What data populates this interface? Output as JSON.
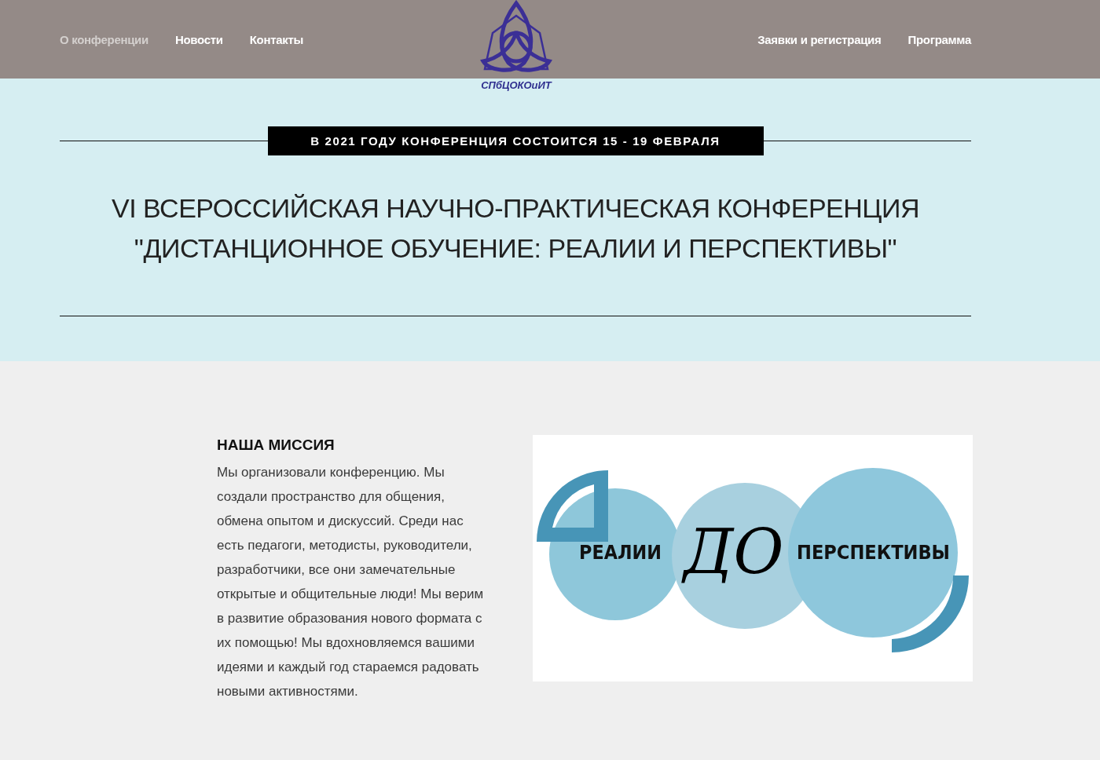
{
  "nav": {
    "left": [
      {
        "label": "О конференции",
        "selected": true
      },
      {
        "label": "Новости",
        "selected": false
      },
      {
        "label": "Контакты",
        "selected": false
      }
    ],
    "right": [
      {
        "label": "Заявки и регистрация",
        "selected": false
      },
      {
        "label": "Программа",
        "selected": false
      }
    ]
  },
  "logo": {
    "caption": "СПбЦОКОиИТ"
  },
  "hero": {
    "banner": "В 2021 ГОДУ КОНФЕРЕНЦИЯ СОСТОИТСЯ 15 - 19 ФЕВРАЛЯ",
    "title_lines": [
      "VI ВСЕРОССИЙСКАЯ НАУЧНО-ПРАКТИЧЕСКАЯ КОНФЕРЕНЦИЯ",
      "\"ДИСТАНЦИОННОЕ ОБУЧЕНИЕ: РЕАЛИИ И ПЕРСПЕКТИВЫ\""
    ]
  },
  "mission": {
    "heading": "НАША МИССИЯ",
    "text": "Мы организовали конференцию. Мы создали пространство для общения, обмена опытом и дискуссий. Среди нас есть педагоги, методисты, руководители, разработчики, все они замечательные открытые и общительные люди! Мы верим в развитие образования нового формата с их помощью! Мы вдохновляемся вашими идеями и каждый год стараемся радовать новыми активностями."
  },
  "illustration": {
    "words": [
      "РЕАЛИИ",
      "ДО",
      "ПЕРСПЕКТИВЫ"
    ]
  }
}
